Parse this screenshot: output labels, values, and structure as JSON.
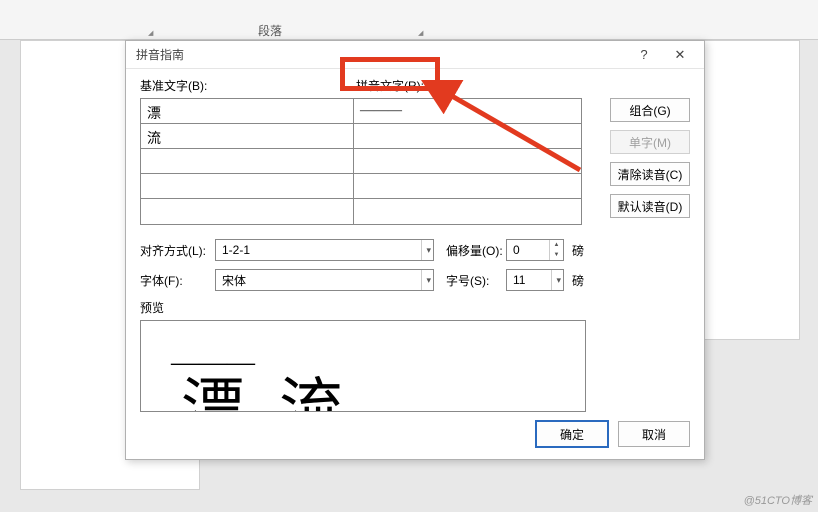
{
  "ribbon": {
    "group_label": "段落"
  },
  "dialog": {
    "title": "拼音指南",
    "help_icon": "?",
    "close_icon": "✕"
  },
  "headers": {
    "base_text": "基准文字(B):",
    "pinyin_text": "拼音文字(R):"
  },
  "grid": {
    "rows": [
      {
        "base": "漂",
        "pinyin": "———"
      },
      {
        "base": "流",
        "pinyin": ""
      },
      {
        "base": "",
        "pinyin": ""
      },
      {
        "base": "",
        "pinyin": ""
      },
      {
        "base": "",
        "pinyin": ""
      }
    ]
  },
  "side_buttons": {
    "group": "组合(G)",
    "single": "单字(M)",
    "clear": "清除读音(C)",
    "default": "默认读音(D)"
  },
  "form": {
    "align_label": "对齐方式(L):",
    "align_value": "1-2-1",
    "offset_label": "偏移量(O):",
    "offset_value": "0",
    "offset_unit": "磅",
    "font_label": "字体(F):",
    "font_value": "宋体",
    "size_label": "字号(S):",
    "size_value": "11",
    "size_unit": "磅"
  },
  "preview": {
    "label": "预览",
    "items": [
      {
        "ruby": "———",
        "base": "漂"
      },
      {
        "ruby": "",
        "base": "流"
      }
    ]
  },
  "buttons": {
    "ok": "确定",
    "cancel": "取消"
  },
  "watermark": "@51CTO博客"
}
